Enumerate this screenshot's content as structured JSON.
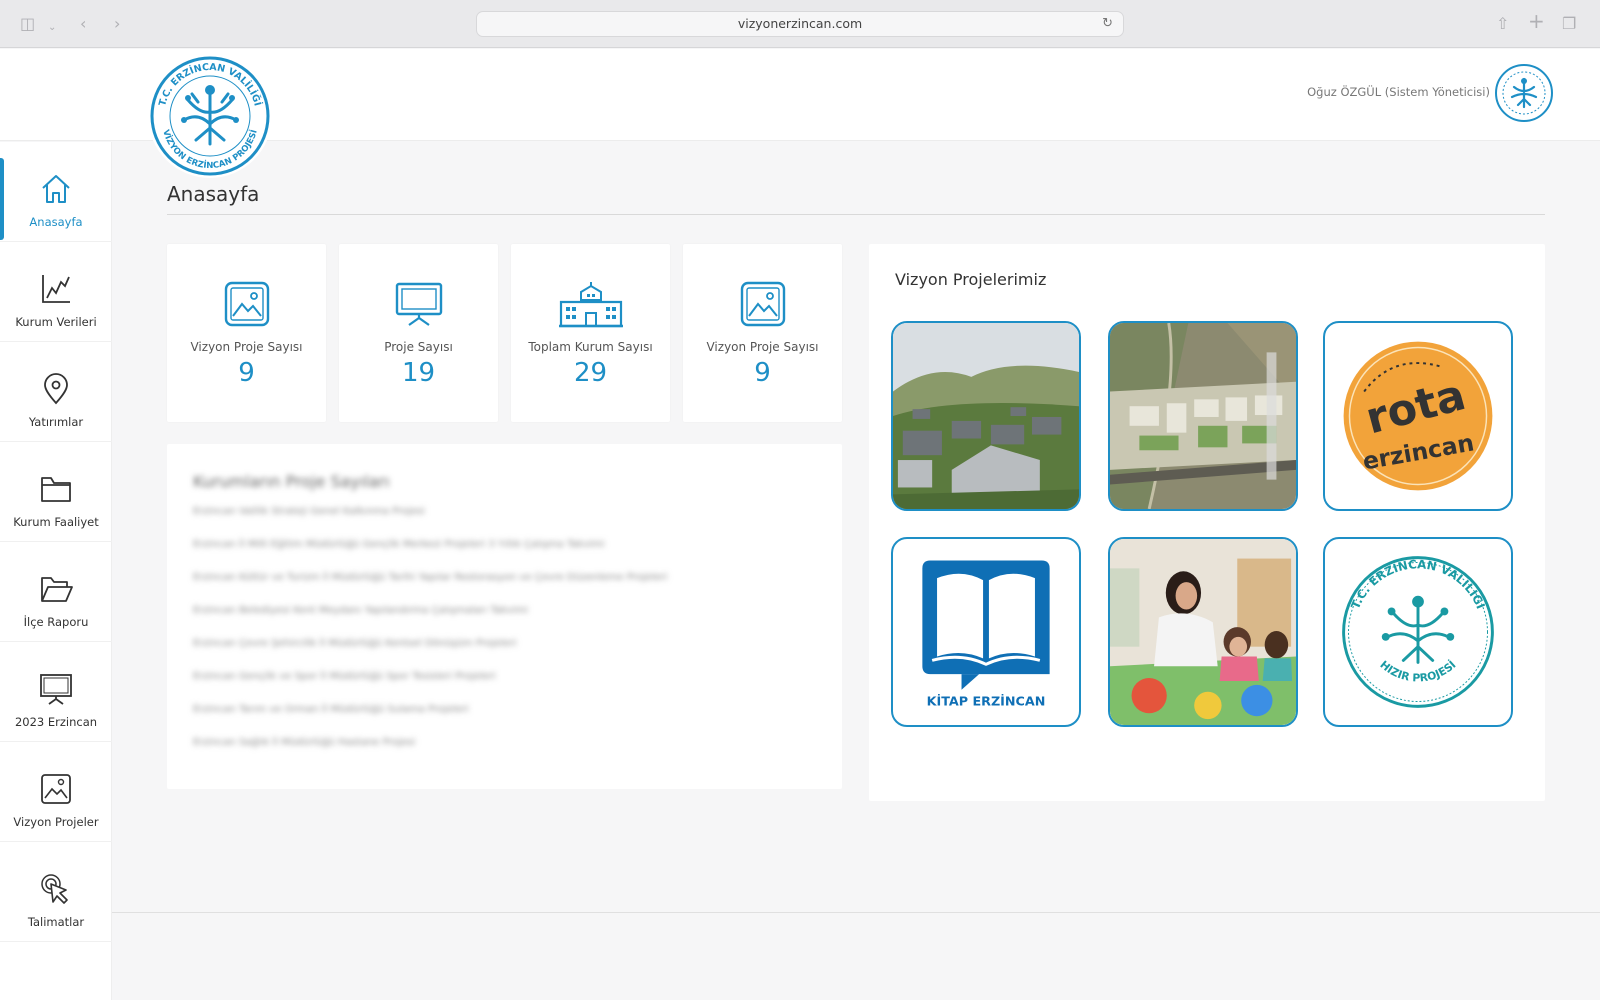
{
  "browser": {
    "url": "vizyonerzincan.com"
  },
  "header": {
    "logo_ring_text": "T.C. ERZİNCAN VALİLİĞİ",
    "logo_bottom_text": "VİZYON ERZİNCAN PROJESİ",
    "user_label": "Oğuz ÖZGÜL (Sistem Yöneticisi)"
  },
  "sidebar": {
    "items": [
      {
        "label": "Anasayfa",
        "icon": "home-icon",
        "active": true
      },
      {
        "label": "Kurum Verileri",
        "icon": "line-chart-icon"
      },
      {
        "label": "Yatırımlar",
        "icon": "map-pin-icon"
      },
      {
        "label": "Kurum Faaliyet",
        "icon": "folder-icon"
      },
      {
        "label": "İlçe Raporu",
        "icon": "folder-open-icon"
      },
      {
        "label": "2023 Erzincan",
        "icon": "presentation-icon"
      },
      {
        "label": "Vizyon Projeler",
        "icon": "image-icon"
      },
      {
        "label": "Talimatlar",
        "icon": "pointer-click-icon"
      }
    ]
  },
  "main": {
    "page_title": "Anasayfa",
    "stats": [
      {
        "label": "Vizyon Proje Sayısı",
        "value": "9",
        "icon": "image-icon"
      },
      {
        "label": "Proje Sayısı",
        "value": "19",
        "icon": "presentation-icon"
      },
      {
        "label": "Toplam Kurum Sayısı",
        "value": "29",
        "icon": "building-icon"
      },
      {
        "label": "Vizyon Proje Sayısı",
        "value": "9",
        "icon": "image-icon"
      }
    ],
    "institution_panel": {
      "title": "Kurumların Proje Sayıları",
      "lines": [
        "Erzincan Valilik Strateji Genel Kalkınma Projesi",
        "Erzincan İl Milli Eğitim Müdürlüğü Gençlik Merkezi Projeleri 3 Yıllık Çalışma Takvimi",
        "Erzincan Kültür ve Turizm İl Müdürlüğü Tarihi Yapılar Restorasyon ve Çevre Düzenleme Projeleri",
        "Erzincan Belediyesi Kent Meydanı Yapılandırma Çalışmaları Takvimi",
        "Erzincan Çevre Şehircilik İl Müdürlüğü Kentsel Dönüşüm Projeleri",
        "Erzincan Gençlik ve Spor İl Müdürlüğü Spor Tesisleri Projeleri",
        "Erzincan Tarım ve Orman İl Müdürlüğü Sulama Projeleri",
        "Erzincan Sağlık İl Müdürlüğü Hastane Projesi"
      ]
    },
    "vision_panel": {
      "title": "Vizyon Projelerimiz",
      "tiles": [
        {
          "kind": "village-photo"
        },
        {
          "kind": "aerial-site-plan"
        },
        {
          "kind": "rota-logo",
          "text_top": "rota",
          "text_bottom": "erzincan"
        },
        {
          "kind": "kitap-logo",
          "text": "KİTAP ERZİNCAN"
        },
        {
          "kind": "classroom-photo"
        },
        {
          "kind": "hizir-logo",
          "text_top": "T.C. ERZİNCAN VALİLİĞİ",
          "text_bottom": "HIZIR PROJESİ"
        }
      ]
    }
  },
  "colors": {
    "accent": "#1e8fc6",
    "kitap_blue": "#0f6fb5",
    "rota_orange": "#f2a33a",
    "hizir_teal": "#1a9aa3"
  }
}
